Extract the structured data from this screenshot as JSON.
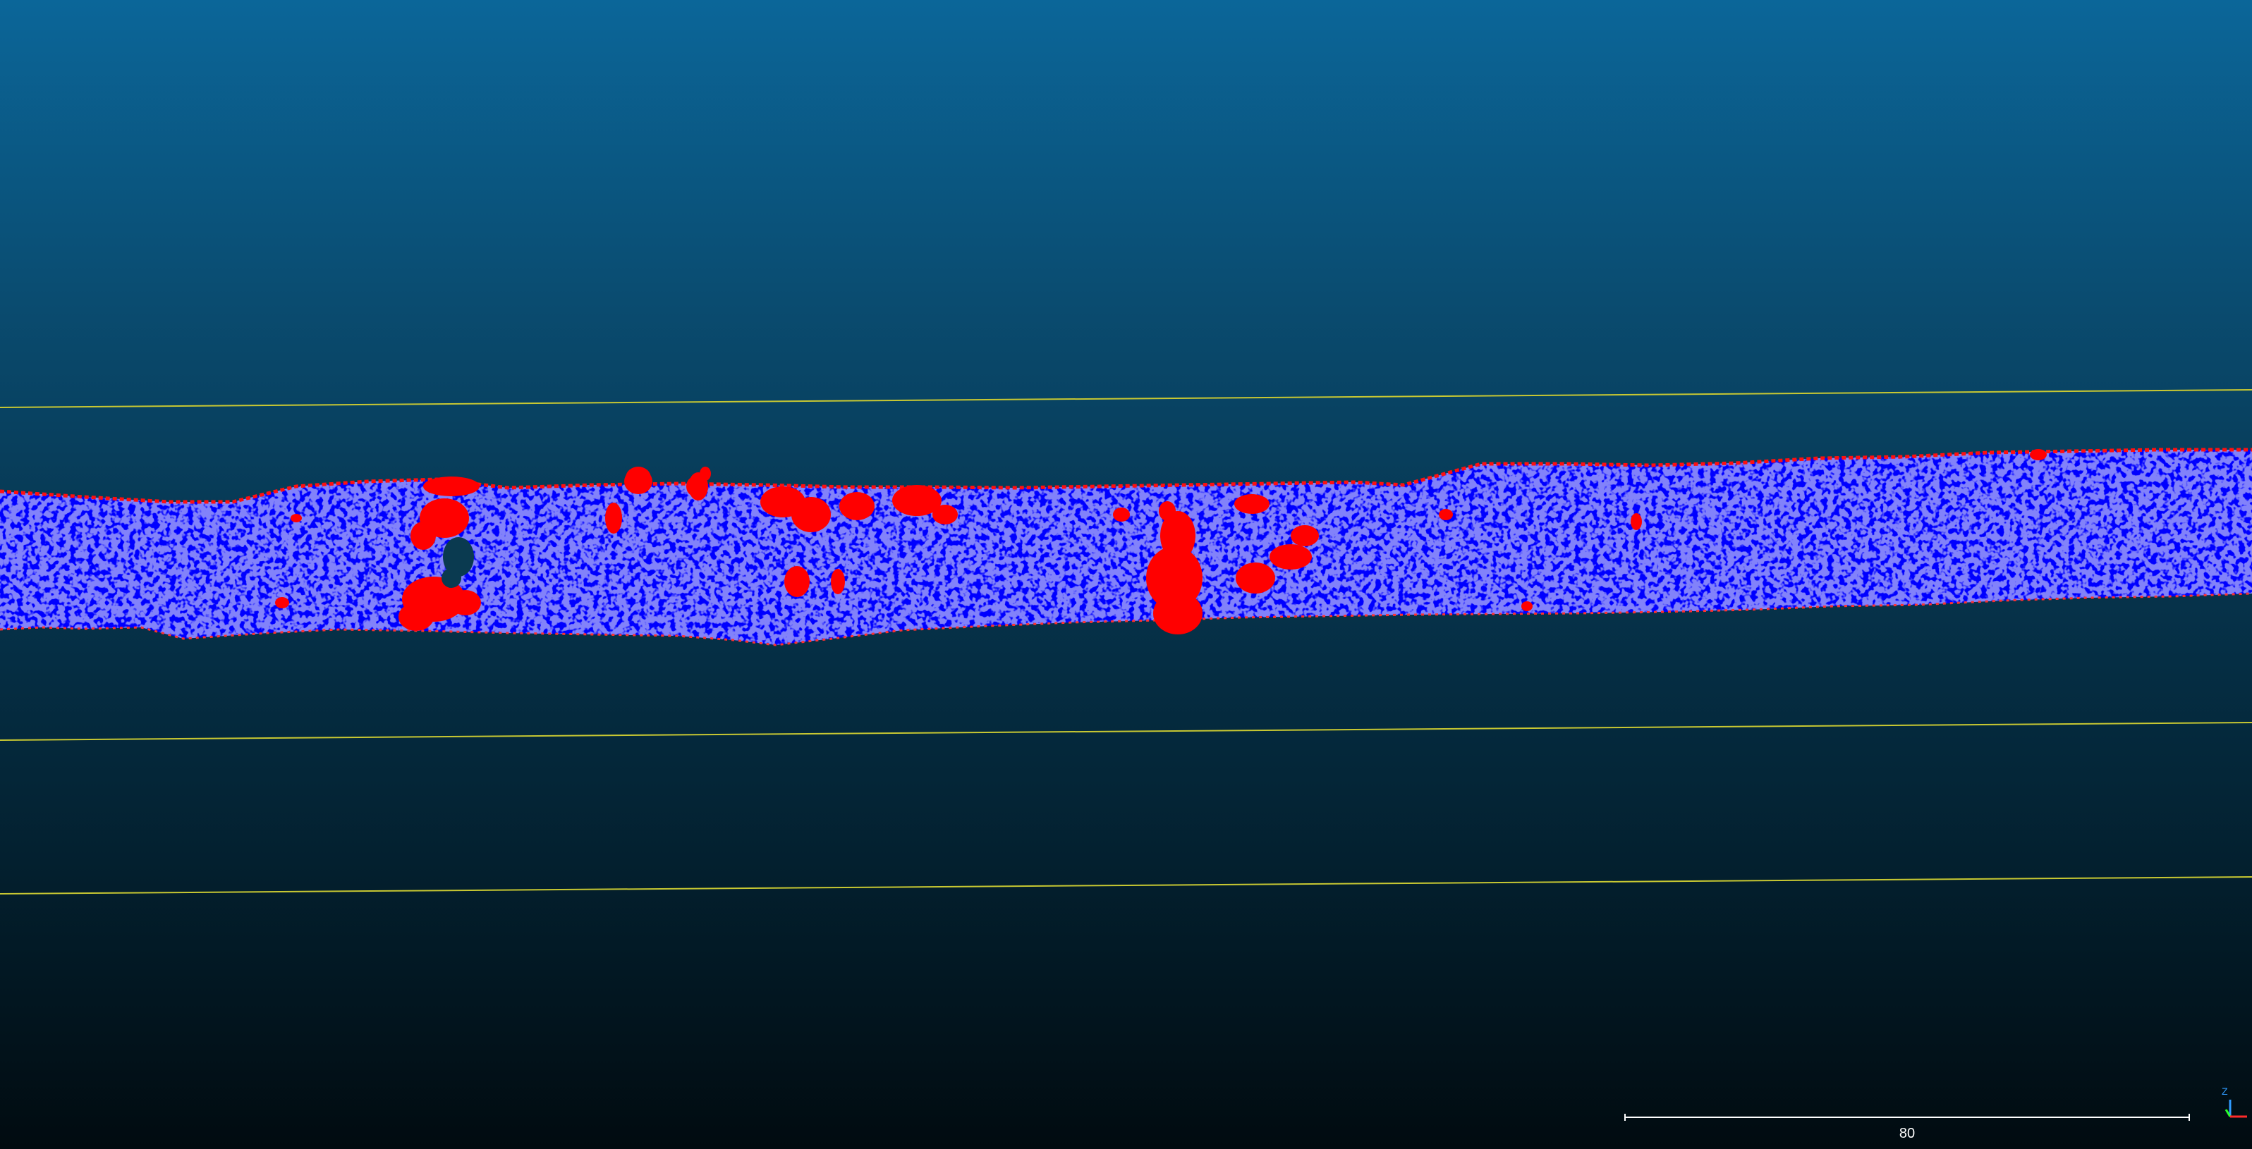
{
  "view": {
    "background_top": "#0b6699",
    "background_bottom": "#010b10",
    "guide_line_color": "#c8c832",
    "cloud_base_color": "#0000ff",
    "cloud_highlight_color": "#ff0000",
    "cloud_noise_color": "#c8c8dc"
  },
  "scale_bar": {
    "label": "80"
  },
  "axis_gizmo": {
    "z_label": "Z",
    "x_color": "#ff2a2a",
    "y_color": "#2aff2a",
    "z_color": "#2f9bff"
  }
}
